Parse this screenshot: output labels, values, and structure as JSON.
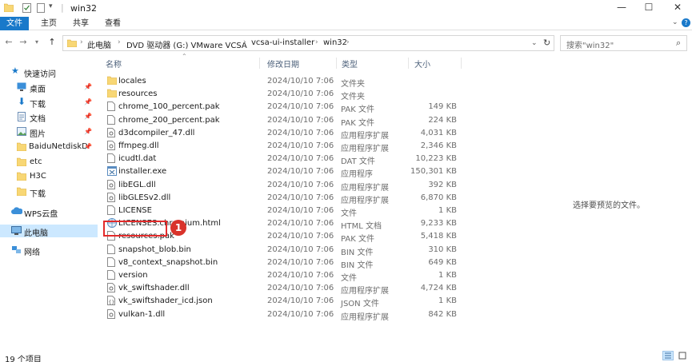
{
  "window": {
    "title": "win32",
    "controls": {
      "minimize": "—",
      "maximize": "☐",
      "close": "✕"
    }
  },
  "ribbon": {
    "tabs": [
      {
        "label": "文件",
        "active": true
      },
      {
        "label": "主页"
      },
      {
        "label": "共享"
      },
      {
        "label": "查看"
      }
    ]
  },
  "address": {
    "breadcrumb": [
      "此电脑",
      "DVD 驱动器 (G:) VMware VCSA",
      "vcsa-ui-installer",
      "win32"
    ],
    "search_placeholder": "搜索\"win32\""
  },
  "nav": {
    "items": [
      {
        "label": "快速访问",
        "icon": "star-icon"
      },
      {
        "label": "桌面",
        "icon": "desktop-icon",
        "pinned": true
      },
      {
        "label": "下载",
        "icon": "download-icon",
        "pinned": true
      },
      {
        "label": "文档",
        "icon": "document-icon",
        "pinned": true
      },
      {
        "label": "图片",
        "icon": "picture-icon",
        "pinned": true
      },
      {
        "label": "BaiduNetdiskD",
        "icon": "folder-icon",
        "pinned": true
      },
      {
        "label": "etc",
        "icon": "folder-icon"
      },
      {
        "label": "H3C",
        "icon": "folder-icon"
      },
      {
        "label": "下载",
        "icon": "folder-icon"
      },
      {
        "label": "WPS云盘",
        "icon": "cloud-icon"
      },
      {
        "label": "此电脑",
        "icon": "computer-icon",
        "selected": true
      },
      {
        "label": "网络",
        "icon": "network-icon"
      }
    ]
  },
  "columns": {
    "name": "名称",
    "date": "修改日期",
    "type": "类型",
    "size": "大小"
  },
  "files": [
    {
      "name": "locales",
      "date": "2024/10/10 7:06",
      "type": "文件夹",
      "size": "",
      "icon": "folder-icon"
    },
    {
      "name": "resources",
      "date": "2024/10/10 7:06",
      "type": "文件夹",
      "size": "",
      "icon": "folder-icon"
    },
    {
      "name": "chrome_100_percent.pak",
      "date": "2024/10/10 7:06",
      "type": "PAK 文件",
      "size": "149 KB",
      "icon": "file-icon"
    },
    {
      "name": "chrome_200_percent.pak",
      "date": "2024/10/10 7:06",
      "type": "PAK 文件",
      "size": "224 KB",
      "icon": "file-icon"
    },
    {
      "name": "d3dcompiler_47.dll",
      "date": "2024/10/10 7:06",
      "type": "应用程序扩展",
      "size": "4,031 KB",
      "icon": "dll-icon"
    },
    {
      "name": "ffmpeg.dll",
      "date": "2024/10/10 7:06",
      "type": "应用程序扩展",
      "size": "2,346 KB",
      "icon": "dll-icon"
    },
    {
      "name": "icudtl.dat",
      "date": "2024/10/10 7:06",
      "type": "DAT 文件",
      "size": "10,223 KB",
      "icon": "file-icon"
    },
    {
      "name": "installer.exe",
      "date": "2024/10/10 7:06",
      "type": "应用程序",
      "size": "150,301 KB",
      "icon": "exe-icon"
    },
    {
      "name": "libEGL.dll",
      "date": "2024/10/10 7:06",
      "type": "应用程序扩展",
      "size": "392 KB",
      "icon": "dll-icon"
    },
    {
      "name": "libGLESv2.dll",
      "date": "2024/10/10 7:06",
      "type": "应用程序扩展",
      "size": "6,870 KB",
      "icon": "dll-icon"
    },
    {
      "name": "LICENSE",
      "date": "2024/10/10 7:06",
      "type": "文件",
      "size": "1 KB",
      "icon": "file-icon"
    },
    {
      "name": "LICENSES.chromium.html",
      "date": "2024/10/10 7:06",
      "type": "HTML 文档",
      "size": "9,233 KB",
      "icon": "html-icon"
    },
    {
      "name": "resources.pak",
      "date": "2024/10/10 7:06",
      "type": "PAK 文件",
      "size": "5,418 KB",
      "icon": "file-icon"
    },
    {
      "name": "snapshot_blob.bin",
      "date": "2024/10/10 7:06",
      "type": "BIN 文件",
      "size": "310 KB",
      "icon": "file-icon"
    },
    {
      "name": "v8_context_snapshot.bin",
      "date": "2024/10/10 7:06",
      "type": "BIN 文件",
      "size": "649 KB",
      "icon": "file-icon"
    },
    {
      "name": "version",
      "date": "2024/10/10 7:06",
      "type": "文件",
      "size": "1 KB",
      "icon": "file-icon"
    },
    {
      "name": "vk_swiftshader.dll",
      "date": "2024/10/10 7:06",
      "type": "应用程序扩展",
      "size": "4,724 KB",
      "icon": "dll-icon"
    },
    {
      "name": "vk_swiftshader_icd.json",
      "date": "2024/10/10 7:06",
      "type": "JSON 文件",
      "size": "1 KB",
      "icon": "json-icon"
    },
    {
      "name": "vulkan-1.dll",
      "date": "2024/10/10 7:06",
      "type": "应用程序扩展",
      "size": "842 KB",
      "icon": "dll-icon"
    }
  ],
  "annotation": {
    "marker": "1"
  },
  "preview": {
    "empty_text": "选择要预览的文件。"
  },
  "status": {
    "count": "19 个项目"
  },
  "colors": {
    "accent": "#1979ca",
    "folder": "#f8d775",
    "highlight": "#e32b2b",
    "marker": "#d9332b",
    "selected": "#cce8ff"
  }
}
